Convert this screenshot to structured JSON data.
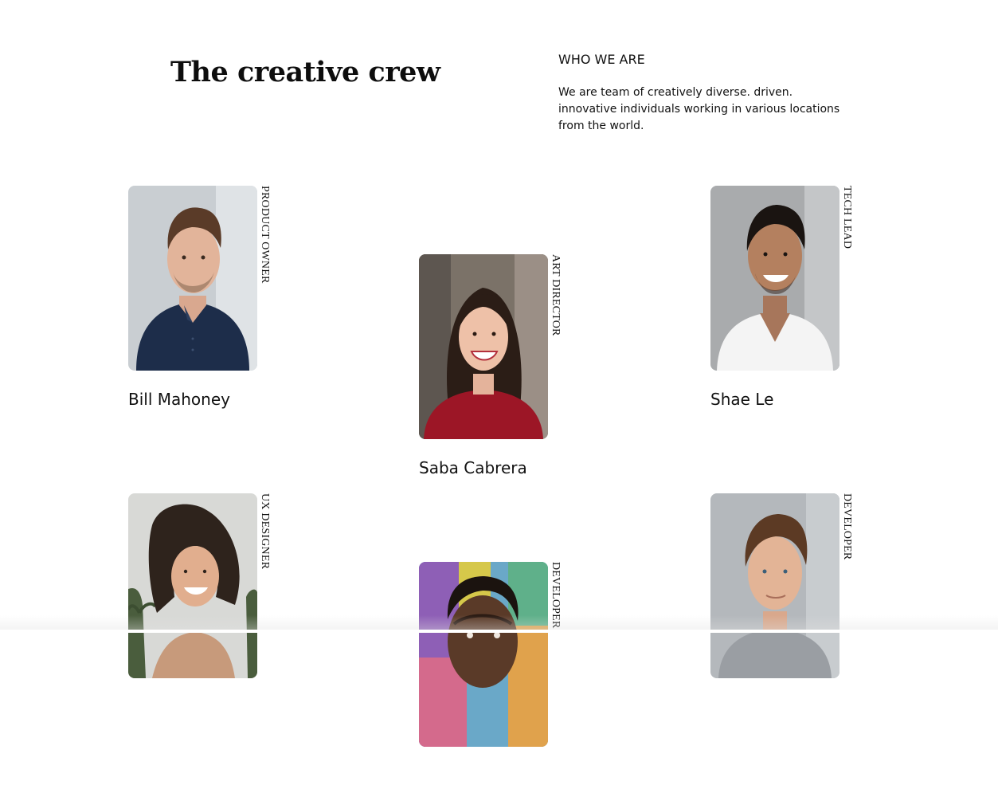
{
  "header": {
    "title": "The creative crew",
    "about_heading": "WHO WE ARE",
    "about_text": "We are team of creatively diverse. driven. innovative individuals working in various locations from the world."
  },
  "team": [
    {
      "name": "Bill Mahoney",
      "role": "PRODUCT OWNER",
      "photo": "portrait-man-navy-polo"
    },
    {
      "name": "Saba Cabrera",
      "role": "ART DIRECTOR",
      "photo": "portrait-woman-red-sweater"
    },
    {
      "name": "Shae Le",
      "role": "TECH LEAD",
      "photo": "portrait-man-white-tshirt"
    },
    {
      "name": "",
      "role": "UX DESIGNER",
      "photo": "portrait-woman-palm-trees"
    },
    {
      "name": "",
      "role": "DEVELOPER",
      "photo": "portrait-man-colorful-wall"
    },
    {
      "name": "",
      "role": "DEVELOPER",
      "photo": "portrait-man-grey-shirt"
    }
  ]
}
